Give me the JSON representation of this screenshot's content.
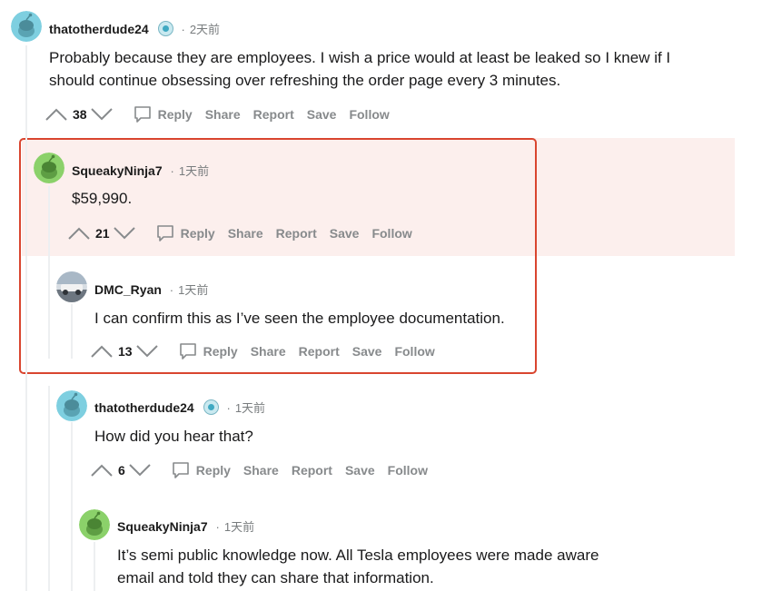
{
  "comments": [
    {
      "username": "thatotherdude24",
      "time": "2天前",
      "body": [
        "Probably because they are employees. I wish a price would at least be leaked so I knew if I",
        "should continue obsessing over refreshing the order page every 3 minutes."
      ],
      "score": "38"
    },
    {
      "username": "SqueakyNinja7",
      "time": "1天前",
      "body": [
        "$59,990."
      ],
      "score": "21"
    },
    {
      "username": "DMC_Ryan",
      "time": "1天前",
      "body": [
        "I can confirm this as I’ve seen the employee documentation."
      ],
      "score": "13"
    },
    {
      "username": "thatotherdude24",
      "time": "1天前",
      "body": [
        "How did you hear that?"
      ],
      "score": "6"
    },
    {
      "username": "SqueakyNinja7",
      "time": "1天前",
      "body": [
        "It’s semi public knowledge now. All Tesla employees were made aware",
        "email and told they can share that information."
      ]
    }
  ],
  "actions": {
    "reply": "Reply",
    "share": "Share",
    "report": "Report",
    "save": "Save",
    "follow": "Follow"
  },
  "colors": {
    "highlight_background": "#fcefed",
    "highlight_border": "#d9452f",
    "avatar_blue": "#7ecfe0",
    "avatar_green": "#8bd16a",
    "meta_gray": "#787c7e"
  },
  "icons": {
    "upvote": "upvote-arrow-icon",
    "downvote": "downvote-arrow-icon",
    "reply": "speech-bubble-icon",
    "badge": "achievement-badge-icon"
  }
}
